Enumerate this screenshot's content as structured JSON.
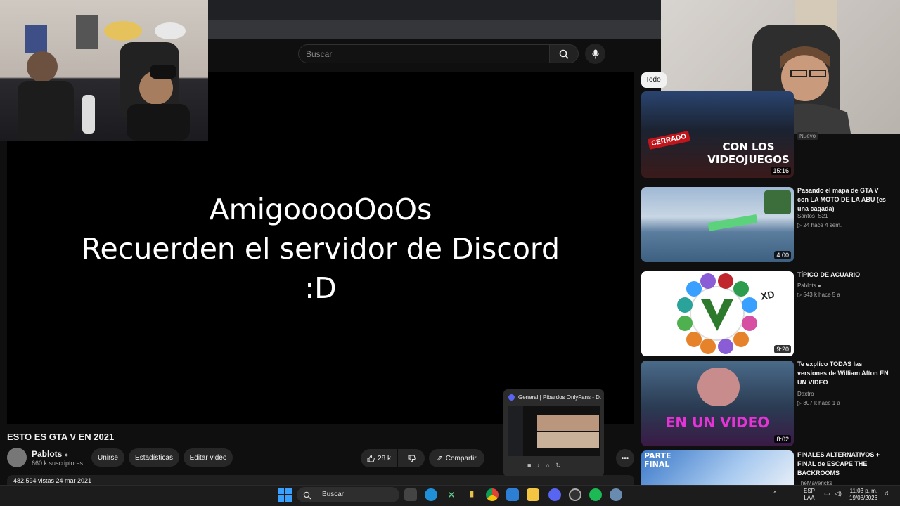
{
  "search": {
    "placeholder": "Buscar"
  },
  "player": {
    "overlay_lines": [
      "AmigooooOoOs",
      "Recuerden el servidor de Discord",
      ":D"
    ]
  },
  "video": {
    "title": "ESTO ES GTA V EN 2021",
    "channel_name": "Pablots",
    "channel_subs": "660 k suscriptores",
    "join_label": "Unirse",
    "stats_label": "Estadísticas",
    "edit_label": "Editar video",
    "likes": "28 k",
    "share_label": "Compartir",
    "description_meta": "482.594 vistas  24 mar 2021"
  },
  "sidebar": {
    "chip_all": "Todo",
    "badge_new": "Nuevo",
    "recommendations": [
      {
        "title": "",
        "channel": "",
        "meta": "",
        "duration": "15:16",
        "thumb_text": "CON LOS VIDEOJUEGOS",
        "thumb_tag": "CERRADO"
      },
      {
        "title": "Pasando el mapa de GTA V con LA MOTO DE LA ABU (es una cagada)",
        "channel": "Santos_S21",
        "meta": "24  hace 4 sem.",
        "duration": "4:00"
      },
      {
        "title": "TÍPICO DE ACUARIO",
        "channel": "Pablots",
        "meta": "543 k  hace 5 a",
        "duration": "9:20",
        "thumb_text": "XD"
      },
      {
        "title": "Te explico TODAS las versiones de William Afton EN UN VIDEO",
        "channel": "Daxtro",
        "meta": "307 k  hace 1 a",
        "duration": "8:02",
        "thumb_text": "EN UN VIDEO"
      },
      {
        "title": "FINALES ALTERNATIVOS + FINAL de ESCAPE THE BACKROOMS",
        "channel": "TheMavericks",
        "meta": "",
        "duration": "",
        "thumb_text": "PARTE FINAL"
      }
    ]
  },
  "discord_preview": {
    "title": "General | Pibardos OnlyFans - D..."
  },
  "taskbar": {
    "search_label": "Buscar",
    "lang_top": "ESP",
    "lang_bottom": "LAA",
    "time": "11:03 p. m.",
    "date": "19/08/2026"
  },
  "colors": {
    "youtube_bg": "#0f0f0f",
    "accent_blue": "#3aa0ff",
    "discord": "#5865f2"
  }
}
